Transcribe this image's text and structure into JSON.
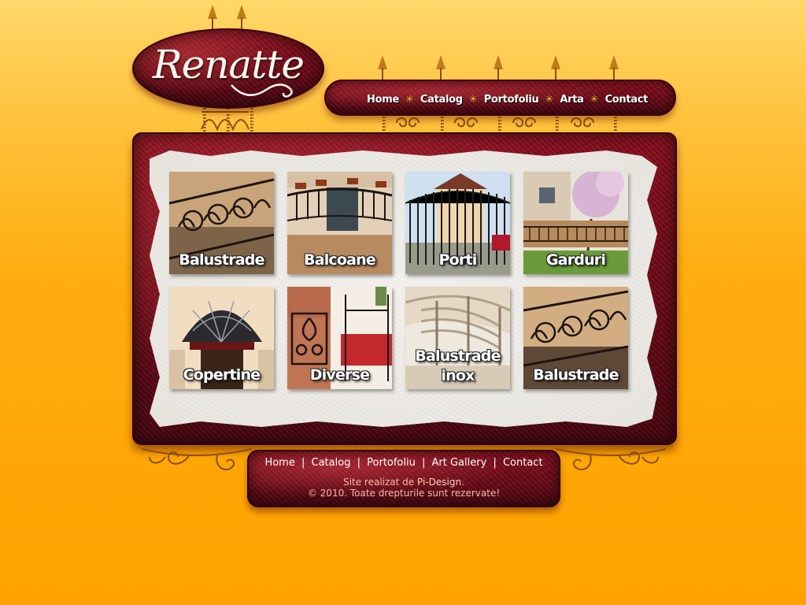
{
  "logo": {
    "text": "Renatte"
  },
  "nav": {
    "items": [
      {
        "label": "Home"
      },
      {
        "label": "Catalog"
      },
      {
        "label": "Portofoliu"
      },
      {
        "label": "Arta"
      },
      {
        "label": "Contact"
      }
    ],
    "separator_icon": "star-icon"
  },
  "gallery": {
    "tiles": [
      {
        "label": "Balustrade"
      },
      {
        "label": "Balcoane"
      },
      {
        "label": "Porti"
      },
      {
        "label": "Garduri"
      },
      {
        "label": "Copertine"
      },
      {
        "label": "Diverse"
      },
      {
        "label_line1": "Balustrade",
        "label_line2": "inox"
      },
      {
        "label": "Balustrade"
      }
    ]
  },
  "footer": {
    "links": [
      {
        "label": "Home"
      },
      {
        "label": "Catalog"
      },
      {
        "label": "Portofoliu"
      },
      {
        "label": "Art Gallery"
      },
      {
        "label": "Contact"
      }
    ],
    "separator": "|",
    "credit_prefix": "Site realizat de ",
    "credit_brand": "Pi-Design",
    "credit_suffix": ".",
    "copyright": "© 2010. Toate drepturile sunt rezervate!"
  },
  "colors": {
    "background_top": "#ffd86a",
    "background_bottom": "#ffa200",
    "velvet_red": "#7a0c1a",
    "paper": "#efece7",
    "accent_gold": "#ffc93a"
  }
}
